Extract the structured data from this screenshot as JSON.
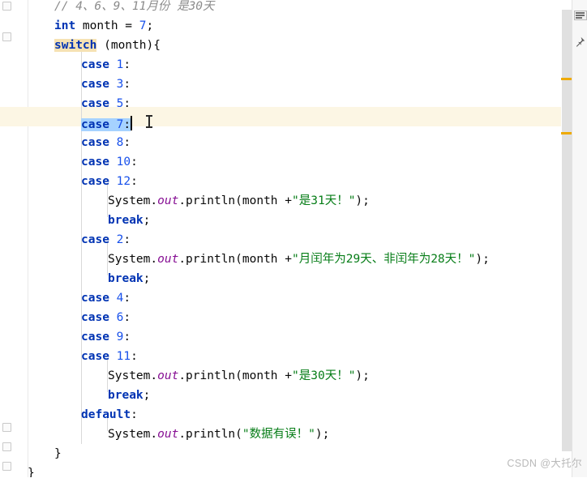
{
  "window": {
    "app": "IntelliJ IDEA code editor",
    "language": "Java"
  },
  "editor": {
    "lines": [
      {
        "indent": 0,
        "tokens": [
          {
            "t": "// 4、6、9、11月份 是30天",
            "c": "comment"
          }
        ]
      },
      {
        "indent": 0,
        "tokens": [
          {
            "t": "int",
            "c": "kw"
          },
          {
            "t": " month = ",
            "c": "plain"
          },
          {
            "t": "7",
            "c": "num"
          },
          {
            "t": ";",
            "c": "plain"
          }
        ]
      },
      {
        "indent": 0,
        "tokens": [
          {
            "t": "switch",
            "c": "kw-hl"
          },
          {
            "t": " (month){",
            "c": "plain"
          }
        ]
      },
      {
        "indent": 1,
        "tokens": [
          {
            "t": "case",
            "c": "kw"
          },
          {
            "t": " ",
            "c": "plain"
          },
          {
            "t": "1",
            "c": "num"
          },
          {
            "t": ":",
            "c": "plain"
          }
        ]
      },
      {
        "indent": 1,
        "tokens": [
          {
            "t": "case",
            "c": "kw"
          },
          {
            "t": " ",
            "c": "plain"
          },
          {
            "t": "3",
            "c": "num"
          },
          {
            "t": ":",
            "c": "plain"
          }
        ]
      },
      {
        "indent": 1,
        "tokens": [
          {
            "t": "case",
            "c": "kw"
          },
          {
            "t": " ",
            "c": "plain"
          },
          {
            "t": "5",
            "c": "num"
          },
          {
            "t": ":",
            "c": "plain"
          }
        ]
      },
      {
        "indent": 1,
        "selected": true,
        "tokens": [
          {
            "t": "case",
            "c": "kw"
          },
          {
            "t": " ",
            "c": "plain"
          },
          {
            "t": "7",
            "c": "num"
          },
          {
            "t": ":",
            "c": "plain"
          }
        ]
      },
      {
        "indent": 1,
        "tokens": [
          {
            "t": "case",
            "c": "kw"
          },
          {
            "t": " ",
            "c": "plain"
          },
          {
            "t": "8",
            "c": "num"
          },
          {
            "t": ":",
            "c": "plain"
          }
        ]
      },
      {
        "indent": 1,
        "tokens": [
          {
            "t": "case",
            "c": "kw"
          },
          {
            "t": " ",
            "c": "plain"
          },
          {
            "t": "10",
            "c": "num"
          },
          {
            "t": ":",
            "c": "plain"
          }
        ]
      },
      {
        "indent": 1,
        "tokens": [
          {
            "t": "case",
            "c": "kw"
          },
          {
            "t": " ",
            "c": "plain"
          },
          {
            "t": "12",
            "c": "num"
          },
          {
            "t": ":",
            "c": "plain"
          }
        ]
      },
      {
        "indent": 2,
        "tokens": [
          {
            "t": "System.",
            "c": "plain"
          },
          {
            "t": "out",
            "c": "field-static"
          },
          {
            "t": ".println(month +",
            "c": "plain"
          },
          {
            "t": "\"是31天！\"",
            "c": "str"
          },
          {
            "t": ");",
            "c": "plain"
          }
        ]
      },
      {
        "indent": 2,
        "tokens": [
          {
            "t": "break",
            "c": "kw"
          },
          {
            "t": ";",
            "c": "plain"
          }
        ]
      },
      {
        "indent": 1,
        "tokens": [
          {
            "t": "case",
            "c": "kw"
          },
          {
            "t": " ",
            "c": "plain"
          },
          {
            "t": "2",
            "c": "num"
          },
          {
            "t": ":",
            "c": "plain"
          }
        ]
      },
      {
        "indent": 2,
        "tokens": [
          {
            "t": "System.",
            "c": "plain"
          },
          {
            "t": "out",
            "c": "field-static"
          },
          {
            "t": ".println(month +",
            "c": "plain"
          },
          {
            "t": "\"月闰年为29天、非闰年为28天！\"",
            "c": "str"
          },
          {
            "t": ");",
            "c": "plain"
          }
        ]
      },
      {
        "indent": 2,
        "tokens": [
          {
            "t": "break",
            "c": "kw"
          },
          {
            "t": ";",
            "c": "plain"
          }
        ]
      },
      {
        "indent": 1,
        "tokens": [
          {
            "t": "case",
            "c": "kw"
          },
          {
            "t": " ",
            "c": "plain"
          },
          {
            "t": "4",
            "c": "num"
          },
          {
            "t": ":",
            "c": "plain"
          }
        ]
      },
      {
        "indent": 1,
        "tokens": [
          {
            "t": "case",
            "c": "kw"
          },
          {
            "t": " ",
            "c": "plain"
          },
          {
            "t": "6",
            "c": "num"
          },
          {
            "t": ":",
            "c": "plain"
          }
        ]
      },
      {
        "indent": 1,
        "tokens": [
          {
            "t": "case",
            "c": "kw"
          },
          {
            "t": " ",
            "c": "plain"
          },
          {
            "t": "9",
            "c": "num"
          },
          {
            "t": ":",
            "c": "plain"
          }
        ]
      },
      {
        "indent": 1,
        "tokens": [
          {
            "t": "case",
            "c": "kw"
          },
          {
            "t": " ",
            "c": "plain"
          },
          {
            "t": "11",
            "c": "num"
          },
          {
            "t": ":",
            "c": "plain"
          }
        ]
      },
      {
        "indent": 2,
        "tokens": [
          {
            "t": "System.",
            "c": "plain"
          },
          {
            "t": "out",
            "c": "field-static"
          },
          {
            "t": ".println(month +",
            "c": "plain"
          },
          {
            "t": "\"是30天！\"",
            "c": "str"
          },
          {
            "t": ");",
            "c": "plain"
          }
        ]
      },
      {
        "indent": 2,
        "tokens": [
          {
            "t": "break",
            "c": "kw"
          },
          {
            "t": ";",
            "c": "plain"
          }
        ]
      },
      {
        "indent": 1,
        "tokens": [
          {
            "t": "default",
            "c": "kw"
          },
          {
            "t": ":",
            "c": "plain"
          }
        ]
      },
      {
        "indent": 2,
        "tokens": [
          {
            "t": "System.",
            "c": "plain"
          },
          {
            "t": "out",
            "c": "field-static"
          },
          {
            "t": ".println(",
            "c": "plain"
          },
          {
            "t": "\"数据有误！\"",
            "c": "str"
          },
          {
            "t": ");",
            "c": "plain"
          }
        ]
      },
      {
        "indent": 0,
        "tokens": [
          {
            "t": "}",
            "c": "plain"
          }
        ]
      },
      {
        "indent": -1,
        "tokens": [
          {
            "t": "}",
            "c": "plain"
          }
        ]
      }
    ],
    "selection_text": "case 7:",
    "highlight_text": "switch"
  },
  "colors": {
    "keyword": "#0033b3",
    "number": "#1750eb",
    "string": "#067d17",
    "static_field": "#871094",
    "comment": "#8c8c8c",
    "selection_bg": "#a6d2ff",
    "search_match_bg": "#f6e2b3",
    "caret_row_bg": "#fcf6e4",
    "warning_marker": "#eeaa00",
    "scrollbar_thumb": "#e0e0e0",
    "editor_bg": "#ffffff"
  },
  "gutter": {
    "fold_markers": 5
  },
  "scrollbar": {
    "warning_marks": 2
  },
  "tool_strip": {
    "buttons": [
      {
        "icon": "structure-lines-icon"
      },
      {
        "icon": "pin-icon"
      }
    ]
  },
  "watermark": {
    "text": "CSDN @大托尔"
  }
}
